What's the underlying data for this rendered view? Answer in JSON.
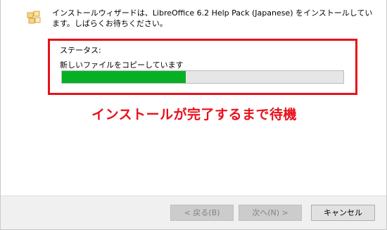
{
  "header": {
    "message": "インストールウィザードは、LibreOffice 6.2 Help Pack (Japanese) をインストールしています。しばらくお待ちください。",
    "icon": "installer-box-icon"
  },
  "status": {
    "label": "ステータス:",
    "detail": "新しいファイルをコピーしています",
    "progress_percent": 44
  },
  "annotation": {
    "text": "インストールが完了するまで待機",
    "color": "#e8101a"
  },
  "footer": {
    "back_label": "< 戻る(B)",
    "next_label": "次へ(N) >",
    "cancel_label": "キャンセル"
  },
  "colors": {
    "progress_fill": "#06b025",
    "highlight_frame": "#e8101a"
  }
}
